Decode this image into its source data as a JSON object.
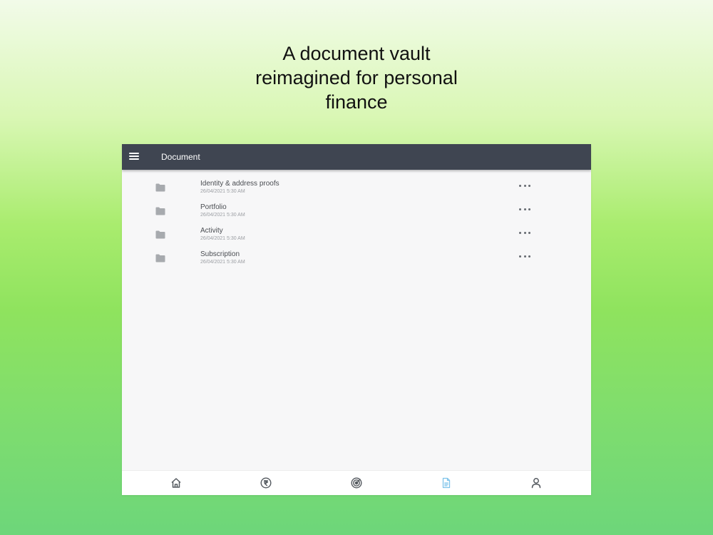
{
  "headline": {
    "line1": "A document vault",
    "line2": "reimagined for personal",
    "line3": "finance"
  },
  "app_bar": {
    "menu_icon": "hamburger-menu-icon",
    "title": "Document"
  },
  "folders": [
    {
      "name": "Identity & address proofs",
      "date": "26/04/2021 5:30 AM",
      "icon": "folder-icon",
      "menu_icon": "more-horizontal-icon"
    },
    {
      "name": "Portfolio",
      "date": "26/04/2021 5:30 AM",
      "icon": "folder-icon",
      "menu_icon": "more-horizontal-icon"
    },
    {
      "name": "Activity",
      "date": "26/04/2021 5:30 AM",
      "icon": "folder-icon",
      "menu_icon": "more-horizontal-icon"
    },
    {
      "name": "Subscription",
      "date": "26/04/2021 5:30 AM",
      "icon": "folder-icon",
      "menu_icon": "more-horizontal-icon"
    }
  ],
  "bottom_nav": {
    "items": [
      {
        "icon": "home-icon",
        "active": false
      },
      {
        "icon": "rupee-icon",
        "active": false
      },
      {
        "icon": "target-icon",
        "active": false
      },
      {
        "icon": "document-icon",
        "active": true
      },
      {
        "icon": "user-icon",
        "active": false
      }
    ],
    "active_color": "#7ec3ea",
    "inactive_color": "#555a60"
  },
  "colors": {
    "app_bar": "#3f4551",
    "content_background": "#f7f7f8",
    "folder_icon": "#a7aaae"
  }
}
